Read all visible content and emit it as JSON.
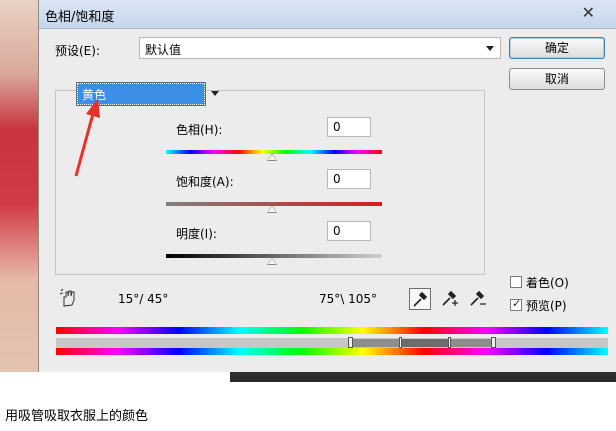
{
  "dialog": {
    "title": "色相/饱和度",
    "close_glyph": "✕"
  },
  "preset": {
    "label": "预设(E):",
    "value": "默认值"
  },
  "buttons": {
    "ok": "确定",
    "cancel": "取消"
  },
  "channel": {
    "selected": "黄色"
  },
  "sliders": {
    "hue": {
      "label": "色相(H):",
      "value": "0"
    },
    "saturation": {
      "label": "饱和度(A):",
      "value": "0"
    },
    "lightness": {
      "label": "明度(I):",
      "value": "0"
    }
  },
  "range": {
    "left": "15°/ 45°",
    "right": "75°\\ 105°"
  },
  "options": {
    "colorize": {
      "label": "着色(O)",
      "checked": false
    },
    "preview": {
      "label": "预览(P)",
      "checked": true
    }
  },
  "caption": "用吸管吸取衣服上的颜色",
  "colors": {
    "accent": "#3d8ee6",
    "annotation_arrow": "#e8312b"
  },
  "icons": [
    "preset-menu-icon",
    "hand-adjust-icon",
    "eyedropper-icon",
    "eyedropper-plus-icon",
    "eyedropper-minus-icon"
  ]
}
